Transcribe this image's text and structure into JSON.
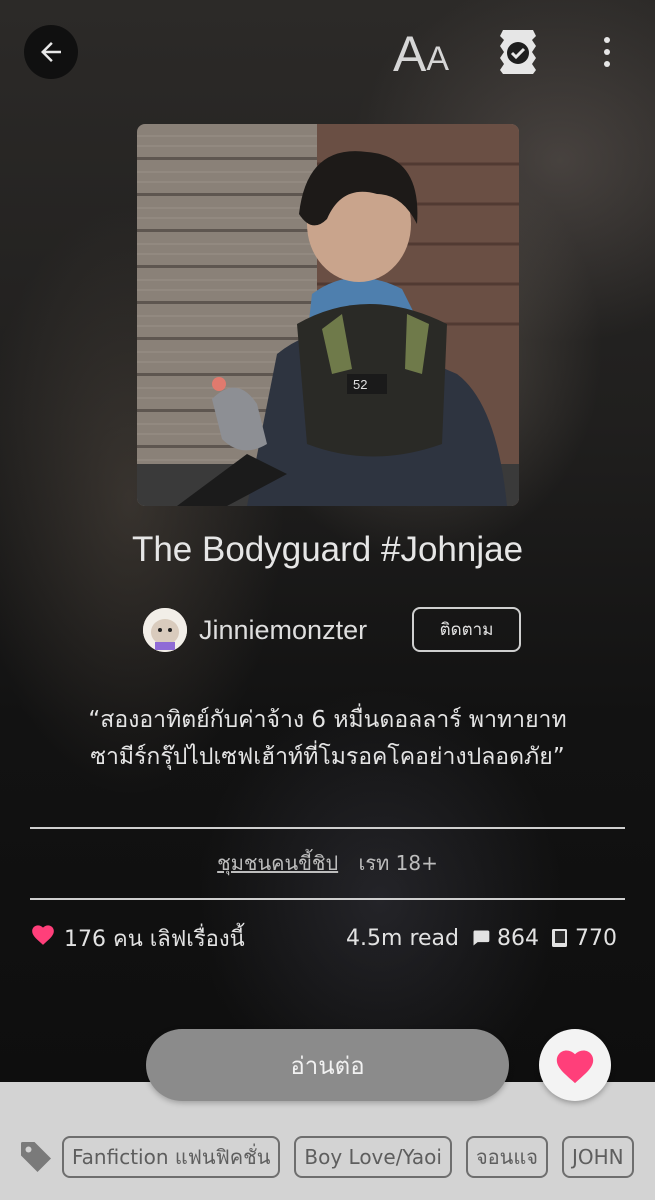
{
  "header": {
    "font_size_label_big": "A",
    "font_size_label_small": "A",
    "icons": [
      "back-arrow-icon",
      "font-size-icon",
      "badge-check-icon",
      "more-vert-icon"
    ]
  },
  "story": {
    "title": "The Bodyguard #Johnjae",
    "author": "Jinniemonzter",
    "follow_label": "ติดตาม",
    "synopsis_line1": "“สองอาทิตย์กับค่าจ้าง 6 หมื่นดอลลาร์ พาทายาท",
    "synopsis_line2": "ซามีร์กรุ๊ปไปเซฟเฮ้าท์ที่โมรอคโคอย่างปลอดภัย”",
    "community": "ชุมชนคนขี้ชิป",
    "rating": "เรท 18+"
  },
  "stats": {
    "likes_text": "176 คน เลิฟเรื่องนี้",
    "reads": "4.5m read",
    "comments": "864",
    "chapters": "770"
  },
  "actions": {
    "read_label": "อ่านต่อ"
  },
  "tags": [
    "Fanfiction แฟนฟิคชั่น",
    "Boy Love/Yaoi",
    "จอนแจ",
    "JOHN"
  ],
  "colors": {
    "heart": "#ff3f7a",
    "read_button": "#8b8b8b",
    "tag_bar": "#d3d3d3"
  }
}
